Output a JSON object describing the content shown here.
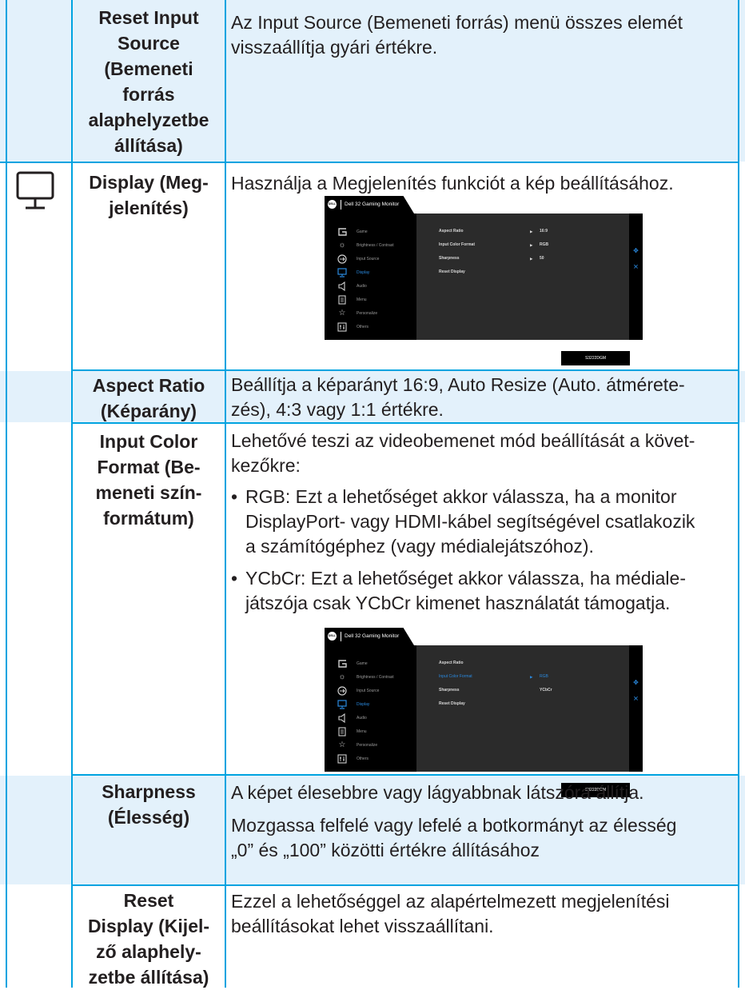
{
  "rows": {
    "reset_input": {
      "label": [
        "Reset Input",
        "Source",
        "(Bemeneti",
        "forrás",
        "alaphelyzetbe",
        "állítása)"
      ],
      "desc": [
        "Az Input Source (Bemeneti forrás) menü összes elemét",
        "visszaállítja gyári értékre."
      ]
    },
    "display": {
      "label": [
        "Display (Meg-",
        "jelenítés)"
      ],
      "desc": "Használja a Megjelenítés funkciót a kép beállításához."
    },
    "aspect": {
      "label": [
        "Aspect Ratio",
        "(Képarány)"
      ],
      "desc": [
        "Beállítja a képarányt 16:9, Auto Resize (Auto. átmérete-",
        "zés), 4:3 vagy 1:1 értékre."
      ]
    },
    "input_color": {
      "label": [
        "Input Color",
        "Format (Be-",
        "meneti szín-",
        "formátum)"
      ],
      "intro": [
        "Lehetővé teszi az videobemenet mód beállítását a követ-",
        "kezőkre:"
      ],
      "bullets": [
        {
          "term": "RGB:",
          "lines": [
            "Ezt a lehetőséget akkor válassza, ha a monitor",
            "DisplayPort- vagy HDMI-kábel segítségével csatlakozik",
            "a számítógéphez (vagy médialejátszóhoz)."
          ]
        },
        {
          "term": "YCbCr:",
          "lines": [
            "Ezt a lehetőséget akkor válassza, ha média­le-",
            "játszója csak YCbCr kimenet használatát támogatja."
          ]
        }
      ]
    },
    "sharpness": {
      "label": [
        "Sharpness",
        "(Élesség)"
      ],
      "desc1": "A képet élesebbre vagy lágyabbnak látszóra állítja.",
      "desc2": [
        "Mozgassa felfelé vagy lefelé a botkormányt az élesség",
        "„0” és „100” közötti értékre állításához"
      ]
    },
    "reset_display": {
      "label": [
        "Reset",
        "Display (Kijel-",
        "ző alaphely-",
        "zetbe állítása)"
      ],
      "desc": [
        "Ezzel a lehetőséggel az alapértelmezett megjelenítési",
        "beállításokat lehet visszaállítani."
      ]
    }
  },
  "osd": {
    "logo": "DELL",
    "title": "Dell 32 Gaming Monitor",
    "model": "S3222DGM",
    "menu": [
      "Game",
      "Brightness / Contrast",
      "Input Source",
      "Display",
      "Audio",
      "Menu",
      "Personalize",
      "Others"
    ],
    "icons": [
      "game-icon",
      "brightness-icon",
      "input-source-icon",
      "display-icon",
      "audio-icon",
      "menu-icon",
      "personalize-icon",
      "others-icon"
    ],
    "options": [
      "Aspect Ratio",
      "Input Color Format",
      "Sharpness",
      "Reset Display"
    ],
    "values1": [
      "16:9",
      "RGB",
      "50"
    ],
    "values2": [
      "RGB",
      "YCbCr"
    ]
  },
  "colors": {
    "border": "#00a3e0",
    "row_highlight": "#e3f1fb",
    "osd_accent": "#2a8ae0"
  }
}
